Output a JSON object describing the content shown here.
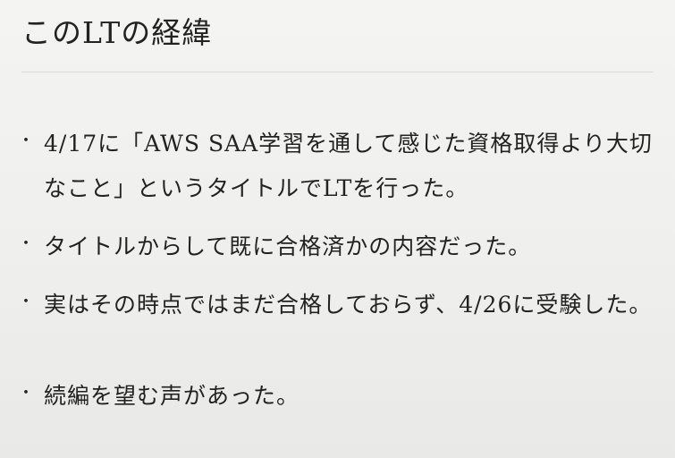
{
  "slide": {
    "title": "このLTの経緯",
    "bullets": [
      {
        "marker": "・",
        "text": "4/17に「AWS SAA学習を通して感じた資格取得より大切なこと」というタイトルでLTを行った。"
      },
      {
        "marker": "・",
        "text": "タイトルからして既に合格済かの内容だった。"
      },
      {
        "marker": "・",
        "text": "実はその時点ではまだ合格しておらず、4/26に受験した。"
      },
      {
        "marker": "・",
        "text": "続編を望む声があった。"
      }
    ]
  }
}
